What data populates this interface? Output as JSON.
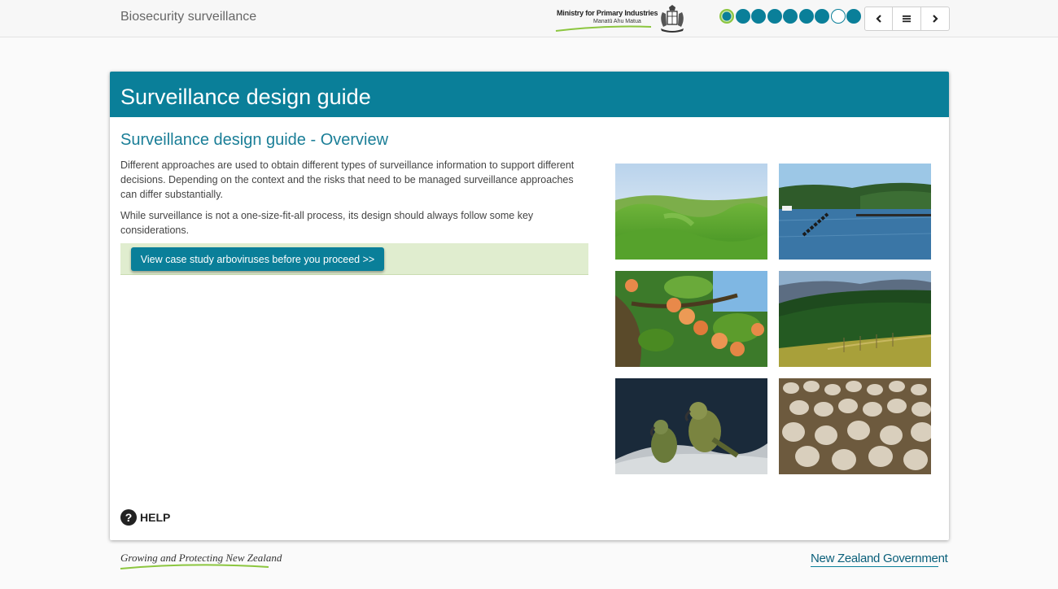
{
  "header": {
    "app_title": "Biosecurity surveillance",
    "logo": {
      "line1": "Ministry for Primary Industries",
      "line2": "Manatū Ahu Matua"
    },
    "progress": {
      "total": 9,
      "current_index": 0,
      "incomplete_index": 7
    },
    "nav": {
      "prev_icon": "chevron-left-icon",
      "menu_icon": "menu-icon",
      "next_icon": "chevron-right-icon"
    }
  },
  "card": {
    "title": "Surveillance design guide",
    "section_title": "Surveillance design guide - Overview",
    "paragraphs": [
      "Different approaches are used to obtain different types of surveillance information to support different decisions. Depending on the context and the risks that need to be managed surveillance approaches can differ substantially.",
      "While surveillance is not a one-size-fit-all process, its design should always follow some key considerations."
    ],
    "cta_label": "View case study arboviruses before you proceed >>",
    "help_label": "HELP",
    "help_icon": "question-circle-icon"
  },
  "footer": {
    "tagline": "Growing and Protecting New Zealand",
    "gov_logo": "New Zealand Government"
  },
  "colors": {
    "brand": "#0a7f99",
    "accent_green": "#8cc63f",
    "cta_background": "#e0edcf"
  }
}
